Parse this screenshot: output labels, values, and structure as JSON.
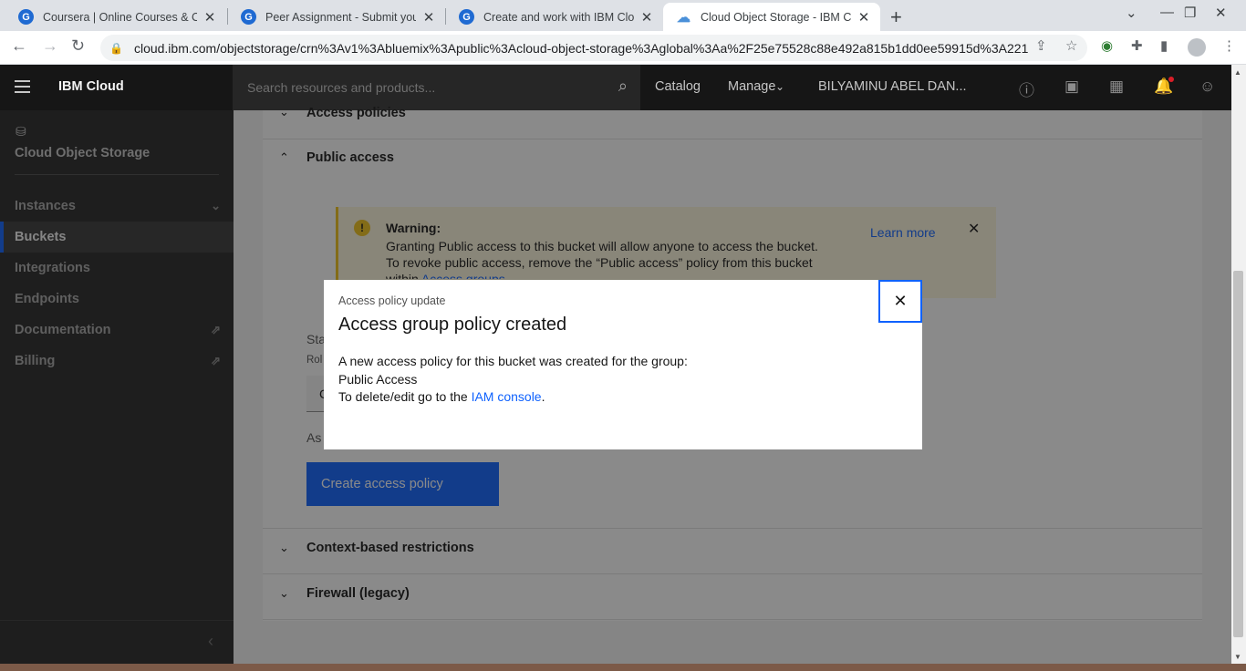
{
  "browser": {
    "tabs": [
      {
        "title": "Coursera | Online Courses & Cred",
        "favicon": "google-favicon"
      },
      {
        "title": "Peer Assignment - Submit your w",
        "favicon": "google-favicon"
      },
      {
        "title": "Create and work with IBM Cloud",
        "favicon": "google-favicon"
      },
      {
        "title": "Cloud Object Storage - IBM Clou",
        "favicon": "ibm-cloud-favicon"
      }
    ],
    "url": "cloud.ibm.com/objectstorage/crn%3Av1%3Abluemix%3Apublic%3Acloud-object-storage%3Aglobal%3Aa%2F25e75528c88e492a815b1dd0ee59915d%3A221..."
  },
  "header": {
    "brand": "IBM Cloud",
    "search_placeholder": "Search resources and products...",
    "catalog": "Catalog",
    "manage": "Manage",
    "account": "BILYAMINU ABEL DAN..."
  },
  "sidebar": {
    "title": "Cloud Object Storage",
    "items": [
      {
        "label": "Instances"
      },
      {
        "label": "Buckets"
      },
      {
        "label": "Integrations"
      },
      {
        "label": "Endpoints"
      },
      {
        "label": "Documentation"
      },
      {
        "label": "Billing"
      }
    ]
  },
  "main": {
    "sections": {
      "access_policies": "Access policies",
      "public_access": "Public access",
      "context_restrictions": "Context-based restrictions",
      "firewall": "Firewall (legacy)"
    },
    "warning": {
      "title": "Warning:",
      "body": "Granting Public access to this bucket will allow anyone to access the bucket. To revoke public access, remove the “Public access” policy from this bucket within",
      "link": "Access groups.",
      "learn_more": "Learn more"
    },
    "fragments": {
      "sta": "Sta",
      "rol": "Rol",
      "as": "As",
      "c": "C"
    },
    "create_button": "Create access policy"
  },
  "modal": {
    "label": "Access policy update",
    "title": "Access group policy created",
    "line1": "A new access policy for this bucket was created for the group:",
    "group": "Public Access",
    "line3_prefix": "To delete/edit go to the",
    "link": "IAM console",
    "line3_suffix": "."
  },
  "colors": {
    "accent": "#0f62fe",
    "warning": "#f1c21b",
    "header_bg": "#161616",
    "sidebar_bg": "#262626"
  }
}
